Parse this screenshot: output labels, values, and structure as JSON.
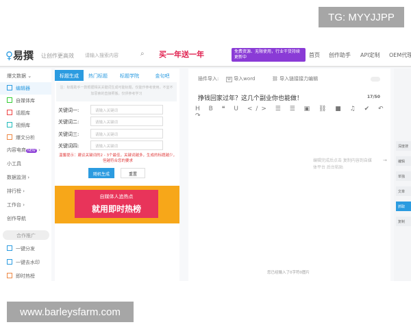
{
  "overlay": {
    "tg": "TG: MYYJJPP",
    "site": "www.barleysfarm.com"
  },
  "header": {
    "logo": "易撰",
    "slogan": "让创作更高效",
    "search_placeholder": "请输入搜索内容",
    "promo1": "买一年送一年",
    "promo2": "免费资源、无限使用，行业干货持续更新中",
    "nav": [
      "首页",
      "创作助手",
      "API定制",
      "OEM代理"
    ]
  },
  "sidebar": {
    "items": [
      {
        "label": "爆文数据"
      },
      {
        "label": "编辑器"
      },
      {
        "label": "自媒体库"
      },
      {
        "label": "话题库"
      },
      {
        "label": "视频库"
      },
      {
        "label": "爆文分析"
      },
      {
        "label": "内容电商",
        "badge": "NEW"
      },
      {
        "label": "小工具"
      },
      {
        "label": "数据监测"
      },
      {
        "label": "排行榜"
      },
      {
        "label": "工作台"
      },
      {
        "label": "创作导航"
      }
    ],
    "coop": "合作推广",
    "extra": [
      "一键分发",
      "一键去水印",
      "即时热榜"
    ]
  },
  "left": {
    "tabs": [
      "标题生成",
      "热门标题",
      "标题学院",
      "金句吧"
    ],
    "tip": "注：标题助手一款根据相关关键词生成可能标题，仅能作参考使用，不宜不加思索的直接照搬，仅供参考学习",
    "keywords": [
      {
        "label": "关键词一:",
        "placeholder": "请输入关键词"
      },
      {
        "label": "关键词二:",
        "placeholder": "请输入关键词"
      },
      {
        "label": "关键词三:",
        "placeholder": "请输入关键词"
      },
      {
        "label": "关键词四:",
        "placeholder": "请输入关键词"
      }
    ],
    "warning": "温馨提示：建议关键词的2 - 3个最佳，关键词越多，生成的标题越少，但越符合您的要求",
    "generate": "随机生成",
    "reset": "重置",
    "banner": {
      "line1": "自媒体人追热点",
      "line2": "就用即时热榜"
    }
  },
  "editor": {
    "import_label": "插件导入:",
    "import_word": "导入word",
    "import_link": "导入链接接力编辑",
    "title": "挣钱回家过年？这几个副业你也能做！",
    "count": "17/50",
    "toolbar": "H B ❝ U </> ☰ ☰ ▣ ⛓ ■ ♫ ✔ ↶ ↷",
    "hint": "编辑完成后点击 复制内容到自媒体平台 后台粘贴",
    "status": "您已经输入了0字符0图片"
  },
  "rightpanel": {
    "items": [
      "深度搜",
      "编辑",
      "单独",
      "文章",
      "抓取",
      "复制"
    ]
  }
}
